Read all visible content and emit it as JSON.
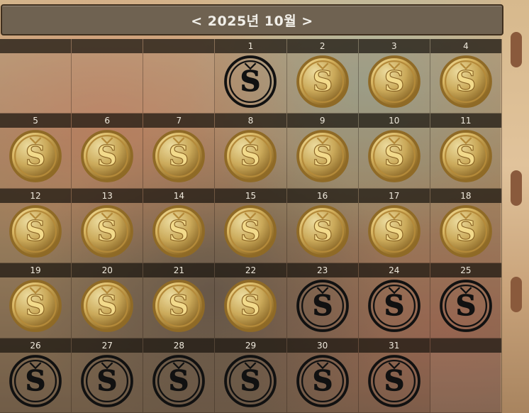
{
  "header": {
    "title": "< 2025년 10월 >"
  },
  "days": [
    {
      "label": "",
      "status": "empty"
    },
    {
      "label": "",
      "status": "empty"
    },
    {
      "label": "",
      "status": "empty"
    },
    {
      "label": "1",
      "status": "inactive"
    },
    {
      "label": "2",
      "status": "active"
    },
    {
      "label": "3",
      "status": "active"
    },
    {
      "label": "4",
      "status": "active"
    },
    {
      "label": "5",
      "status": "active"
    },
    {
      "label": "6",
      "status": "active"
    },
    {
      "label": "7",
      "status": "active"
    },
    {
      "label": "8",
      "status": "active"
    },
    {
      "label": "9",
      "status": "active"
    },
    {
      "label": "10",
      "status": "active"
    },
    {
      "label": "11",
      "status": "active"
    },
    {
      "label": "12",
      "status": "active"
    },
    {
      "label": "13",
      "status": "active"
    },
    {
      "label": "14",
      "status": "active"
    },
    {
      "label": "15",
      "status": "active"
    },
    {
      "label": "16",
      "status": "active"
    },
    {
      "label": "17",
      "status": "active"
    },
    {
      "label": "18",
      "status": "active"
    },
    {
      "label": "19",
      "status": "active"
    },
    {
      "label": "20",
      "status": "active"
    },
    {
      "label": "21",
      "status": "active"
    },
    {
      "label": "22",
      "status": "active"
    },
    {
      "label": "23",
      "status": "inactive"
    },
    {
      "label": "24",
      "status": "inactive"
    },
    {
      "label": "25",
      "status": "inactive"
    },
    {
      "label": "26",
      "status": "inactive"
    },
    {
      "label": "27",
      "status": "inactive"
    },
    {
      "label": "28",
      "status": "inactive"
    },
    {
      "label": "29",
      "status": "inactive"
    },
    {
      "label": "30",
      "status": "inactive"
    },
    {
      "label": "31",
      "status": "inactive"
    },
    {
      "label": "",
      "status": "empty"
    }
  ],
  "colors": {
    "gold": "#d6b35f",
    "gold_dark": "#8f6a26",
    "inactive": "#111111"
  },
  "icon": "s-coin-icon"
}
